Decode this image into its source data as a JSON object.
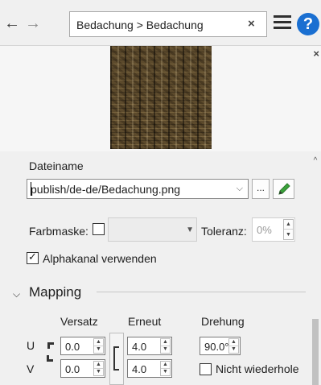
{
  "topbar": {
    "breadcrumb": "Bedachung > Bedachung",
    "clear_label": "×",
    "help_label": "?"
  },
  "preview": {
    "close_label": "×"
  },
  "file": {
    "label": "Dateiname",
    "value": "publish/de-de/Bedachung.png",
    "browse_label": "..."
  },
  "color_mask": {
    "label": "Farbmaske:",
    "checked": false,
    "color_value": "",
    "tolerance_label": "Toleranz:",
    "tolerance_value": "0%"
  },
  "alpha": {
    "label": "Alphakanal verwenden",
    "checked": true,
    "check_glyph": "✓"
  },
  "mapping": {
    "title": "Mapping",
    "columns": {
      "offset": "Versatz",
      "repeat": "Erneut",
      "rotation": "Drehung"
    },
    "rows": {
      "u_label": "U",
      "v_label": "V"
    },
    "offset_u": "0.0",
    "offset_v": "0.0",
    "repeat_u": "4.0",
    "repeat_v": "4.0",
    "rotation": "90.0°",
    "no_repeat_label": "Nicht wiederhole",
    "no_repeat_checked": false
  },
  "colors": {
    "accent": "#1a6fd1",
    "edit_icon": "#3aa23a",
    "background": "#f0f0f0"
  }
}
